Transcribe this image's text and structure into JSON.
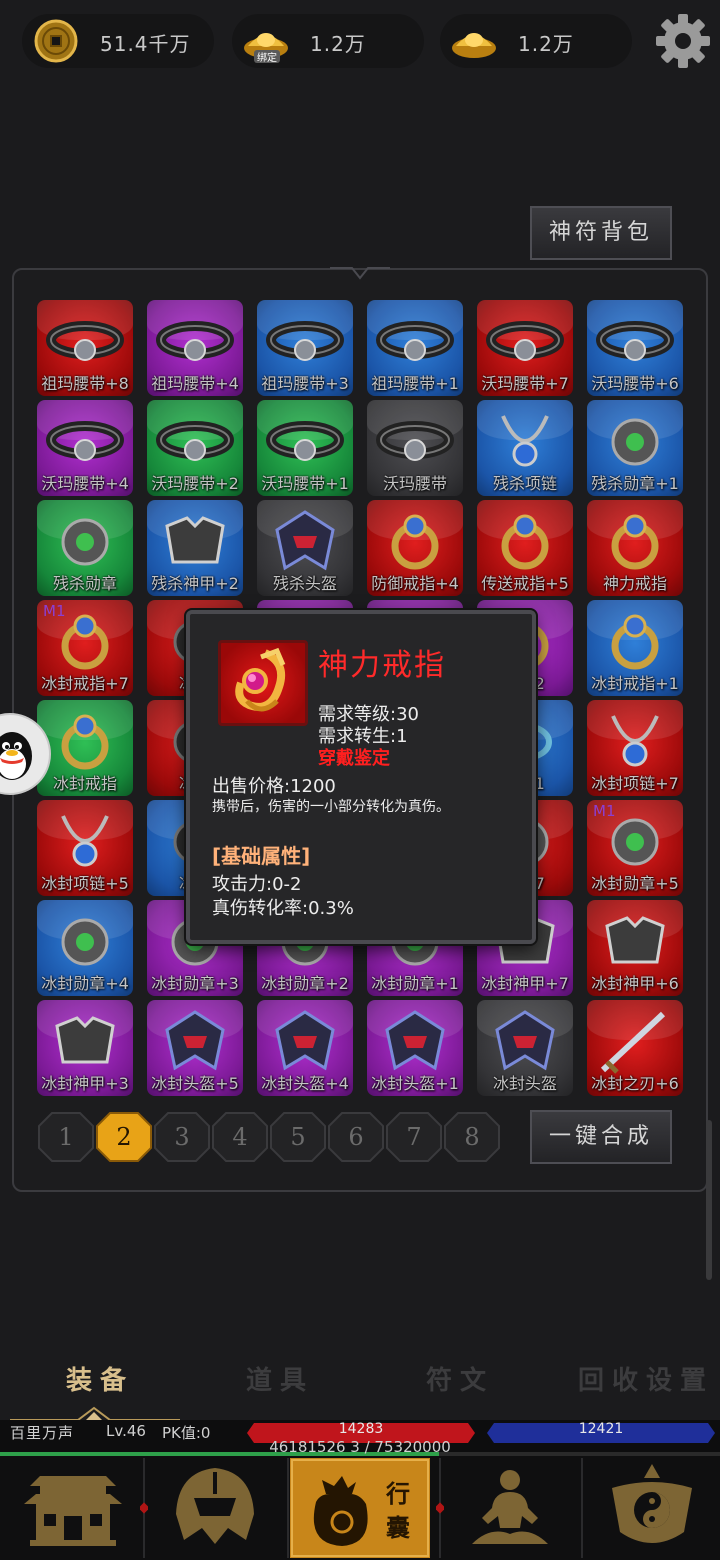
{
  "currency": {
    "copper": "51.4千万",
    "bound_gold": "1.2万",
    "bound_tag": "绑定",
    "gold": "1.2万"
  },
  "bag_button": "神符背包",
  "items": [
    {
      "name": "祖玛腰带+8",
      "q": "red"
    },
    {
      "name": "祖玛腰带+4",
      "q": "pur"
    },
    {
      "name": "祖玛腰带+3",
      "q": "blu"
    },
    {
      "name": "祖玛腰带+1",
      "q": "blu"
    },
    {
      "name": "沃玛腰带+7",
      "q": "red"
    },
    {
      "name": "沃玛腰带+6",
      "q": "blu"
    },
    {
      "name": "沃玛腰带+4",
      "q": "pur"
    },
    {
      "name": "沃玛腰带+2",
      "q": "grn"
    },
    {
      "name": "沃玛腰带+1",
      "q": "grn"
    },
    {
      "name": "沃玛腰带",
      "q": "gry"
    },
    {
      "name": "残杀项链",
      "q": "blu"
    },
    {
      "name": "残杀勋章+1",
      "q": "blu"
    },
    {
      "name": "残杀勋章",
      "q": "grn"
    },
    {
      "name": "残杀神甲+2",
      "q": "blu"
    },
    {
      "name": "残杀头盔",
      "q": "gry"
    },
    {
      "name": "防御戒指+4",
      "q": "red"
    },
    {
      "name": "传送戒指+5",
      "q": "red"
    },
    {
      "name": "神力戒指",
      "q": "red"
    },
    {
      "name": "冰封戒指+7",
      "q": "red",
      "tag": "M1"
    },
    {
      "name": "冰封",
      "q": "red"
    },
    {
      "name": "",
      "q": "pur"
    },
    {
      "name": "",
      "q": "pur"
    },
    {
      "name": "指+2",
      "q": "pur"
    },
    {
      "name": "冰封戒指+1",
      "q": "blu"
    },
    {
      "name": "冰封戒指",
      "q": "grn"
    },
    {
      "name": "冰封",
      "q": "red"
    },
    {
      "name": "",
      "q": "gry"
    },
    {
      "name": "",
      "q": "gry"
    },
    {
      "name": "镯+1",
      "q": "blu"
    },
    {
      "name": "冰封项链+7",
      "q": "red"
    },
    {
      "name": "冰封项链+5",
      "q": "red"
    },
    {
      "name": "冰封",
      "q": "blu"
    },
    {
      "name": "",
      "q": "gry"
    },
    {
      "name": "",
      "q": "gry"
    },
    {
      "name": "章+7",
      "q": "red"
    },
    {
      "name": "冰封勋章+5",
      "q": "red",
      "tag": "M1"
    },
    {
      "name": "冰封勋章+4",
      "q": "blu"
    },
    {
      "name": "冰封勋章+3",
      "q": "pur"
    },
    {
      "name": "冰封勋章+2",
      "q": "pur"
    },
    {
      "name": "冰封勋章+1",
      "q": "pur"
    },
    {
      "name": "冰封神甲+7",
      "q": "pur"
    },
    {
      "name": "冰封神甲+6",
      "q": "red"
    },
    {
      "name": "冰封神甲+3",
      "q": "pur"
    },
    {
      "name": "冰封头盔+5",
      "q": "pur"
    },
    {
      "name": "冰封头盔+4",
      "q": "pur"
    },
    {
      "name": "冰封头盔+1",
      "q": "pur"
    },
    {
      "name": "冰封头盔",
      "q": "gry"
    },
    {
      "name": "冰封之刃+6",
      "q": "red"
    }
  ],
  "pages": [
    "1",
    "2",
    "3",
    "4",
    "5",
    "6",
    "7",
    "8"
  ],
  "active_page": 2,
  "merge_button": "一键合成",
  "tooltip": {
    "title": "神力戒指",
    "req_level": "需求等级:30",
    "req_rebirth": "需求转生:1",
    "identify": "穿戴鉴定",
    "price": "出售价格:1200",
    "desc": "携带后，伤害的一小部分转化为真伤。",
    "attr_header": "[基础属性]",
    "attack": "攻击力:0-2",
    "true_dmg": "真伤转化率:0.3%"
  },
  "tabs": [
    "装备",
    "道具",
    "符文",
    "回收设置"
  ],
  "active_tab": 0,
  "player": {
    "name": "百里万声",
    "level": "Lv.46",
    "pk": "PK值:0",
    "hp": "14283",
    "mp": "12421",
    "exp": "46181526 3 / 75320000"
  },
  "exp_ratio": 0.61,
  "nav": [
    "palace-icon",
    "warrior-helmet-icon",
    "bag-icon",
    "meditation-icon",
    "taiji-icon"
  ],
  "nav_bag_label": "行囊",
  "colors": {
    "red": "#c81414",
    "purple": "#8e23ad",
    "blue": "#1f62bd",
    "green": "#1c9a44",
    "gray": "#3a3a3d",
    "gold": "#e8a317"
  }
}
